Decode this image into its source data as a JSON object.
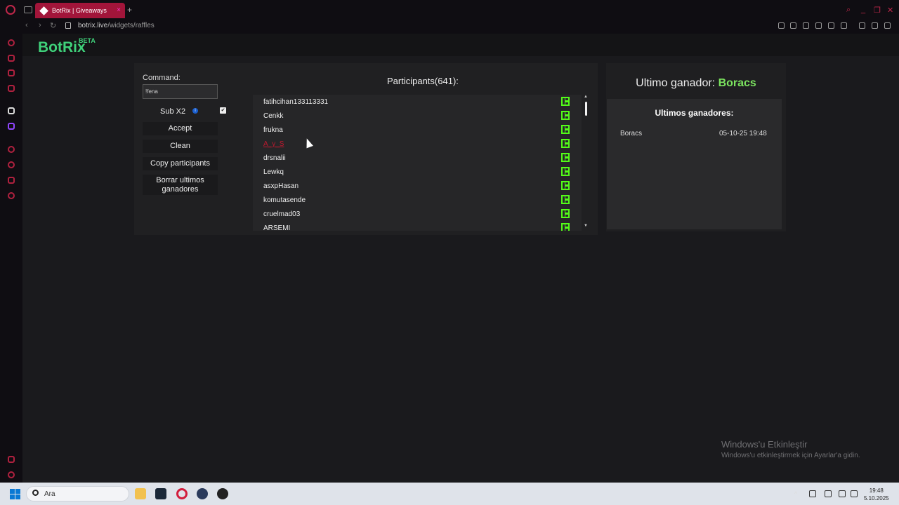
{
  "browser": {
    "tab_title": "BotRix | Giveaways",
    "url_host": "botrix.live",
    "url_path": "/widgets/raffles"
  },
  "header": {
    "brand": "BotRix",
    "beta": "BETA"
  },
  "controls": {
    "command_label": "Command:",
    "command_value": "!fena",
    "sub_label": "Sub X2",
    "info_glyph": "i",
    "checkbox_glyph": "✔",
    "sub_checked": true,
    "accept": "Accept",
    "clean": "Clean",
    "copy": "Copy participants",
    "borrar": "Borrar ultimos ganadores"
  },
  "participants": {
    "title": "Participants(641):",
    "list": [
      {
        "name": "fatihcihan133113331",
        "highlight": false
      },
      {
        "name": "Cenkk",
        "highlight": false
      },
      {
        "name": "frukna",
        "highlight": false
      },
      {
        "name": "A_y_S",
        "highlight": true
      },
      {
        "name": "drsnalii",
        "highlight": false
      },
      {
        "name": "Lewkq",
        "highlight": false
      },
      {
        "name": "asxpHasan",
        "highlight": false
      },
      {
        "name": "komutasende",
        "highlight": false
      },
      {
        "name": "cruelmad03",
        "highlight": false
      },
      {
        "name": "ARSEMI",
        "highlight": false
      }
    ],
    "platform_icon": "kick-icon",
    "platform_color": "#53fc18"
  },
  "winner": {
    "title_prefix": "Ultimo ganador: ",
    "name": "Boracs",
    "list_title": "Ultimos ganadores:",
    "entries": [
      {
        "name": "Boracs",
        "date": "05-10-25 19:48"
      }
    ]
  },
  "watermark": {
    "line1": "Windows'u Etkinleştir",
    "line2": "Windows'u etkinleştirmek için Ayarlar'a gidin."
  },
  "taskbar": {
    "search_placeholder": "Ara",
    "time": "19:48",
    "date": "5.10.2025"
  },
  "colors": {
    "accent": "#3fd17a",
    "opera_red": "#a2153a"
  }
}
